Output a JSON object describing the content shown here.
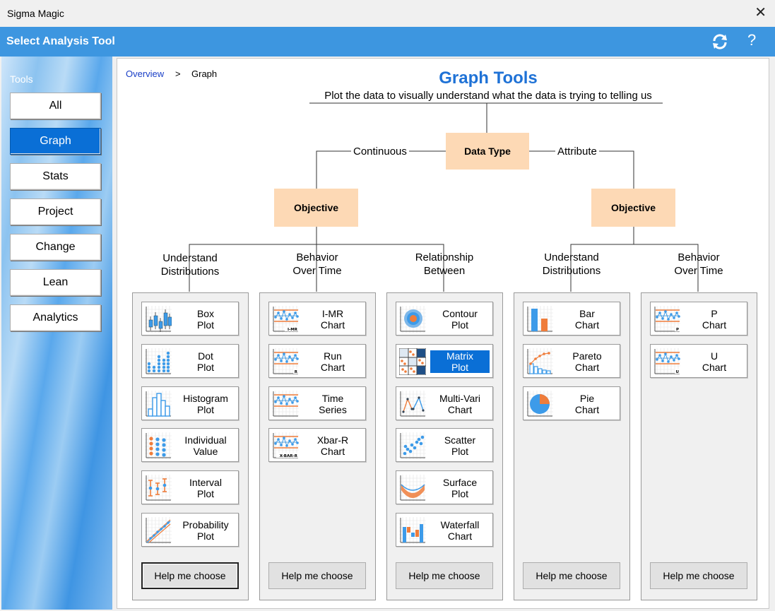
{
  "window": {
    "title": "Sigma Magic"
  },
  "header": {
    "title": "Select Analysis Tool"
  },
  "sidebar": {
    "heading": "Tools",
    "items": [
      {
        "label": "All",
        "active": false
      },
      {
        "label": "Graph",
        "active": true
      },
      {
        "label": "Stats",
        "active": false
      },
      {
        "label": "Project",
        "active": false
      },
      {
        "label": "Change",
        "active": false
      },
      {
        "label": "Lean",
        "active": false
      },
      {
        "label": "Analytics",
        "active": false
      }
    ]
  },
  "breadcrumb": {
    "link": "Overview",
    "separator": ">",
    "current": "Graph"
  },
  "main": {
    "title": "Graph Tools",
    "subtitle": "Plot the data to visually understand what the data is trying to telling us"
  },
  "tree": {
    "root": "Data Type",
    "branch_continuous": "Continuous",
    "branch_attribute": "Attribute",
    "objective_left": "Objective",
    "objective_right": "Objective"
  },
  "categories": [
    {
      "line1": "Understand",
      "line2": "Distributions",
      "help": "Help me choose",
      "tools": [
        {
          "line1": "Box",
          "line2": "Plot",
          "icon": "box-plot-icon"
        },
        {
          "line1": "Dot",
          "line2": "Plot",
          "icon": "dot-plot-icon"
        },
        {
          "line1": "Histogram",
          "line2": "Plot",
          "icon": "histogram-icon"
        },
        {
          "line1": "Individual",
          "line2": "Value",
          "icon": "individual-value-icon"
        },
        {
          "line1": "Interval",
          "line2": "Plot",
          "icon": "interval-plot-icon"
        },
        {
          "line1": "Probability",
          "line2": "Plot",
          "icon": "probability-plot-icon"
        }
      ]
    },
    {
      "line1": "Behavior",
      "line2": "Over Time",
      "help": "Help me choose",
      "tools": [
        {
          "line1": "I-MR",
          "line2": "Chart",
          "icon": "imr-chart-icon",
          "tag": "I-MR"
        },
        {
          "line1": "Run",
          "line2": "Chart",
          "icon": "run-chart-icon",
          "tag": "R"
        },
        {
          "line1": "Time",
          "line2": "Series",
          "icon": "time-series-icon"
        },
        {
          "line1": "Xbar-R",
          "line2": "Chart",
          "icon": "xbar-r-chart-icon",
          "tag": "X-BAR-R"
        }
      ]
    },
    {
      "line1": "Relationship",
      "line2": "Between",
      "help": "Help me choose",
      "tools": [
        {
          "line1": "Contour",
          "line2": "Plot",
          "icon": "contour-plot-icon"
        },
        {
          "line1": "Matrix",
          "line2": "Plot",
          "icon": "matrix-plot-icon",
          "selected": true
        },
        {
          "line1": "Multi-Vari",
          "line2": "Chart",
          "icon": "multi-vari-chart-icon"
        },
        {
          "line1": "Scatter",
          "line2": "Plot",
          "icon": "scatter-plot-icon"
        },
        {
          "line1": "Surface",
          "line2": "Plot",
          "icon": "surface-plot-icon"
        },
        {
          "line1": "Waterfall",
          "line2": "Chart",
          "icon": "waterfall-chart-icon"
        }
      ]
    },
    {
      "line1": "Understand",
      "line2": "Distributions",
      "help": "Help me choose",
      "tools": [
        {
          "line1": "Bar",
          "line2": "Chart",
          "icon": "bar-chart-icon"
        },
        {
          "line1": "Pareto",
          "line2": "Chart",
          "icon": "pareto-chart-icon"
        },
        {
          "line1": "Pie",
          "line2": "Chart",
          "icon": "pie-chart-icon"
        }
      ]
    },
    {
      "line1": "Behavior",
      "line2": "Over Time",
      "help": "Help me choose",
      "tools": [
        {
          "line1": "P",
          "line2": "Chart",
          "icon": "p-chart-icon",
          "tag": "P"
        },
        {
          "line1": "U",
          "line2": "Chart",
          "icon": "u-chart-icon",
          "tag": "U"
        }
      ]
    }
  ],
  "colors": {
    "accent": "#3d96e0",
    "selected": "#0a6fd6",
    "node": "#fdd9b5",
    "title": "#1f72d6",
    "icon_blue": "#3d9be9",
    "icon_orange": "#ef7d3b"
  }
}
